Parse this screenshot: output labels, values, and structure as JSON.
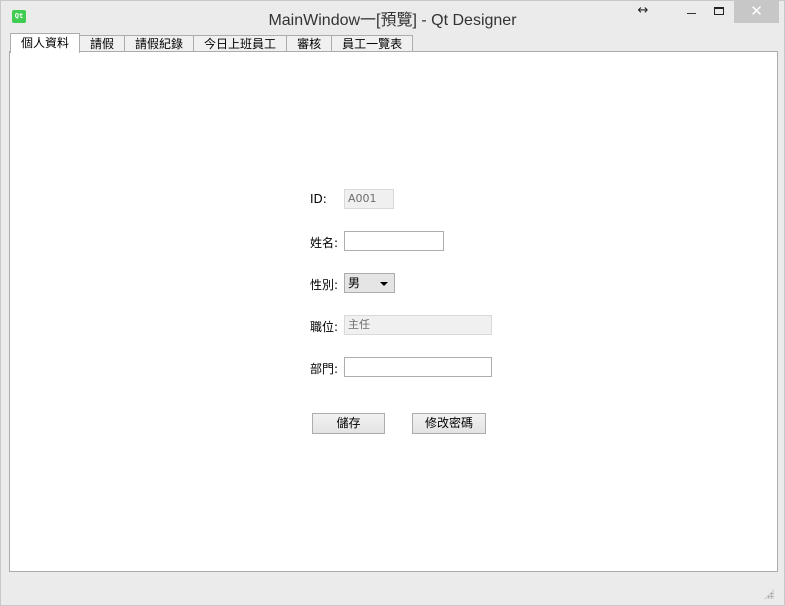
{
  "window": {
    "title": "MainWindow一[預覽] - Qt Designer",
    "icon_label": "Qt",
    "controls": {
      "resize": "↔",
      "close": "✕"
    }
  },
  "tabs": [
    {
      "label": "個人資料",
      "active": true
    },
    {
      "label": "請假"
    },
    {
      "label": "請假紀錄"
    },
    {
      "label": "今日上班員工"
    },
    {
      "label": "審核"
    },
    {
      "label": "員工一覽表"
    }
  ],
  "form": {
    "id_label": "ID:",
    "id_value": "A001",
    "name_label": "姓名:",
    "name_value": "",
    "gender_label": "性別:",
    "gender_value": "男",
    "position_label": "職位:",
    "position_value": "主任",
    "department_label": "部門:",
    "department_value": "",
    "save_button": "儲存",
    "change_password_button": "修改密碼"
  }
}
